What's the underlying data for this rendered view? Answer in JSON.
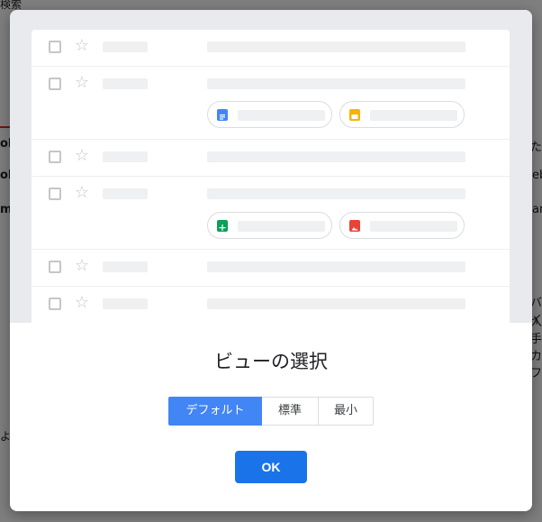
{
  "background": {
    "left_texts": [
      "ok",
      "ok",
      "m"
    ],
    "right_texts": [
      "た",
      "eb",
      "am",
      "バイ",
      "入手",
      "カフ"
    ],
    "top_text": "検索",
    "bottom_text": "よる"
  },
  "dialog": {
    "title": "ビューの選択",
    "view_options": [
      "デフォルト",
      "標準",
      "最小"
    ],
    "selected_option": "デフォルト",
    "ok_label": "OK"
  },
  "preview": {
    "row_count": 6,
    "attachment_icons": [
      "docs-icon",
      "slides-icon",
      "sheets-icon",
      "photos-icon"
    ]
  },
  "colors": {
    "accent": "#1a73e8",
    "segment_active": "#4285f4",
    "docs": "#4285f4",
    "slides": "#f4b400",
    "sheets": "#0f9d58",
    "photos": "#ea4335"
  }
}
